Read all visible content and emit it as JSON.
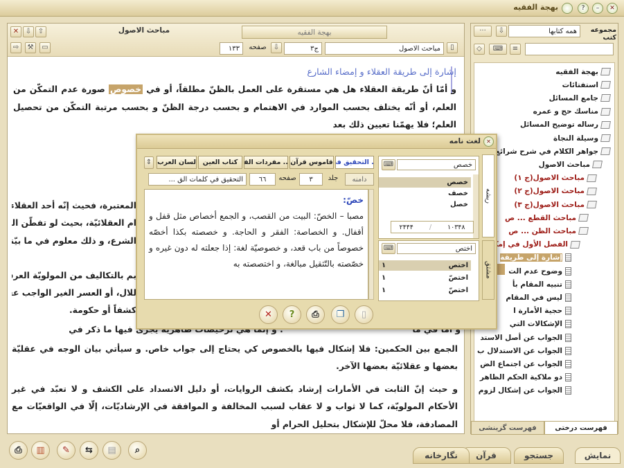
{
  "app": {
    "title": "بهجة الفقيه"
  },
  "left": {
    "tab_label": "بهجة الفقيه",
    "chapter_title": "مباحث الاصول",
    "book_name": "مباحث الاصول",
    "volume": "ج٣",
    "page_label": "صفحه",
    "page_number": "١٣٣",
    "heading": "إشارة إلى طريقة العقلاء و إمضاء الشارع",
    "para1_pre": "و أمّا أنّ طريقة العقلاء هل هي مستقرة على العمل بالظنّ مطلقاً، أو في ",
    "para1_hl": "خصوص",
    "para1_post": " صورة عدم التمكّن من العلم، أو أنّه يختلف بحسب الموارد في الاهتمام و بحسب درجة الظنّ و بحسب مرتبة التمكّن من تحصيل العلم؛ فلا يهمّنا تعيين ذلك بعد",
    "frag1": "المعتبرة، فحيث إنّه أحد العقلاء، بل",
    "frag2": "ام العقلائيّة، بحيث لو تفطّن العقلاء",
    "frag3": "الشرع، و ذلك معلوم في ما بيّنه",
    "frag4": "بم بالتكاليف من المولويّة العرفيّة أو",
    "frag5": "للال، أو العسر الغير الواجب عقلاً و",
    "frag6": "كشفاً أو حكومة.",
    "frag7_pre": "و أمّا في ما",
    "frag7_post": "؛ و إنّما هي ترخيصات ظاهريّة يجرى فيها ما ذكر في",
    "para_end": "الجمع بين الحكمين: فلا إشكال فيها بالخصوص كي يحتاج إلى جواب خاص. و سيأتي بيان الوجه في عقليّة بعضها و عقلائيّة بعضها الآخر.",
    "para_last": "و حيث إنّ الثابت في الأمارات إرشاد بكشف الروايات، أو دليل الانسداد على الكشف و لا تعبّد في غير الأحكام المولويّة، كما لا ثواب و لا عقاب لسبب المخالفة و الموافقة في الإرشاديّات، إلّا في الواقعيّات مع المصادفة، فلا محلّ للإشكال بتحليل الحرام أو"
  },
  "right": {
    "collection_label": "مجموعه كتب",
    "collection_value": "همه كتابها",
    "tree": [
      {
        "label": "بهجة الفقيه",
        "icon": "book-icon",
        "red": false
      },
      {
        "label": "استفتائات",
        "icon": "book-icon",
        "red": false
      },
      {
        "label": "جامع المسائل",
        "icon": "book-icon",
        "red": false
      },
      {
        "label": "مناسك حج و عمره",
        "icon": "book-icon",
        "red": false
      },
      {
        "label": "رساله توضيح المسائل",
        "icon": "book-icon",
        "red": false
      },
      {
        "label": "وسيلة النجاة",
        "icon": "book-icon",
        "red": false
      },
      {
        "label": "جواهر الكلام في شرح شرائع الا",
        "icon": "book-icon",
        "red": false
      },
      {
        "label": "مباحث الاصول",
        "icon": "open-book-icon",
        "red": false
      },
      {
        "label": "مباحث الاصول(ج ١)",
        "icon": "book-icon",
        "red": true
      },
      {
        "label": "مباحث الاصول(ج ٢)",
        "icon": "book-icon",
        "red": true
      },
      {
        "label": "مباحث الاصول(ج ٣)",
        "icon": "open-book-icon",
        "red": true
      },
      {
        "label": "مباحث القطع ... ص",
        "icon": "book-icon",
        "red": true
      },
      {
        "label": "مباحث الظن ... ص",
        "icon": "open-book-icon",
        "red": true
      },
      {
        "label": "الفصل الأول في إمكا",
        "icon": "open-book-icon",
        "red": true
      },
      {
        "label": "إشارة إلى طريقة",
        "icon": "doc-icon",
        "red": false
      },
      {
        "label": "وضوح عدم الت",
        "icon": "doc-icon",
        "red": false
      },
      {
        "label": "تنبيه المقام بأ",
        "icon": "doc-icon",
        "red": false
      },
      {
        "label": "ليس في المقام",
        "icon": "doc-icon",
        "red": false
      },
      {
        "label": "حجية الأمارة ا",
        "icon": "doc-icon",
        "red": false
      },
      {
        "label": "الإشكالات التي",
        "icon": "doc-icon",
        "red": false
      },
      {
        "label": "الجواب عن أصل الاستد",
        "icon": "doc-icon",
        "red": false
      },
      {
        "label": "الجواب عن الاستدلال ب",
        "icon": "doc-icon",
        "red": false
      },
      {
        "label": "الجواب عن اجتماع الض",
        "icon": "doc-icon",
        "red": false
      },
      {
        "label": "دو ملاكية الحكم الظاهر",
        "icon": "doc-icon",
        "red": false
      },
      {
        "label": "الجواب عن إشكال لزوم",
        "icon": "doc-icon",
        "red": false
      }
    ],
    "tab_tree": "فهرست درختى",
    "tab_index": "فهرست گزينشى"
  },
  "bottom_tabs": [
    "نمايش",
    "جستجو",
    "قرآن",
    "نگارخانه"
  ],
  "dialog": {
    "title": "لغت نامه",
    "side_tab_root": "ريشه",
    "side_tab_derived": "مشتق",
    "search_value": "خصص",
    "roots": [
      "خصص",
      "خصف",
      "خصل"
    ],
    "counter_left": "٢۴۴۴",
    "counter_right": "١٠٣۴٨",
    "derived_search": "اختص",
    "derived": [
      {
        "w": "اختص",
        "n": "١"
      },
      {
        "w": "اختصّ",
        "n": "١"
      },
      {
        "w": "اختصّ",
        "n": "١"
      }
    ],
    "tabs": [
      "التحقيق في ...",
      "قاموس قرآن",
      "مفردات الفا ...",
      "كتاب العين",
      "لسان العرب"
    ],
    "book_field": "التحقيق في كلمات الق ...",
    "volume_label": "جلد",
    "volume": "٣",
    "page_label": "صفحه",
    "page": "٦٦",
    "page_num_btn": "دامنه",
    "entry_head": "خصّ:",
    "entry_body": "مصبا – الخصّ: البيت من القصب، و الجمع أخصاص مثل قفل و أقفال. و الخصاصة: الفقر و الحاجة. و خصصته بكذا أخصّه خصوصاً من باب قعد، و خصوصيّة لغة: إذا جعلته له دون غيره و خصّصته بالتّثقيل مبالغة، و اختصصته به"
  },
  "colors": {
    "background": "#e9dfbf",
    "highlight": "#c6a46a",
    "heading": "#5a6fc9",
    "red_item": "#9c1a14"
  }
}
